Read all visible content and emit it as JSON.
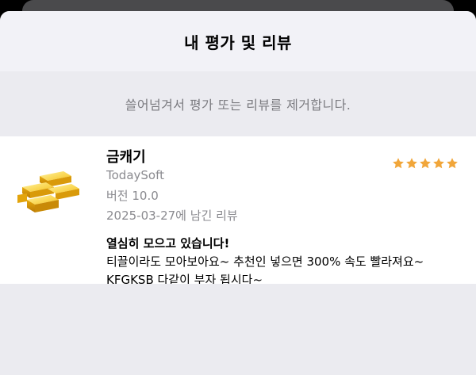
{
  "sheet": {
    "title": "내 평가 및 리뷰",
    "hint": "쓸어넘겨서 평가 또는 리뷰를 제거합니다."
  },
  "review": {
    "app_name": "금캐기",
    "developer": "TodaySoft",
    "version": "버전 10.0",
    "date": "2025-03-27에 남긴 리뷰",
    "rating": 5,
    "star_color": "#f1a63a",
    "icon": "gold-bars-icon",
    "title": "열심히 모으고 있습니다!",
    "body_lines": [
      "티끌이라도 모아보아요~ 추천인 넣으면 300% 속도 빨라져요~",
      "KFGKSB 다같이 부자 됩시다~"
    ]
  }
}
